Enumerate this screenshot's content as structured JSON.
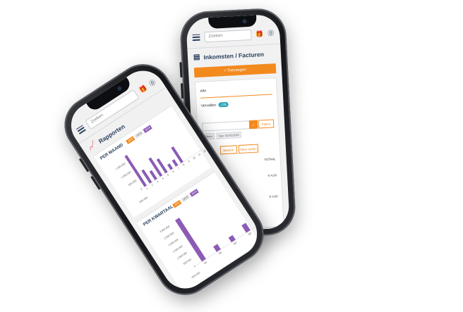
{
  "topbar": {
    "search_placeholder": "Zoeken"
  },
  "back_phone": {
    "title": "Inkomsten / Facturen",
    "new_button": "+ Toevoegen",
    "filter_all": "Alle",
    "filter_expired": "Vervallen",
    "expired_badge": "178",
    "search_button": "Filters",
    "chip_filters": "Filters",
    "chip_from": "Van: 01/01/2022",
    "action_1": "Bewerk",
    "action_2": "Meer opties",
    "col_total": "TOTAAL",
    "amount_1": "€ 4,00",
    "amount_2": "€ 0,00"
  },
  "front_phone": {
    "title": "Rapporten",
    "monthly": {
      "title": "PER MAAND",
      "legend": [
        "2022",
        "2023",
        "2024"
      ]
    },
    "quarterly": {
      "title": "PER KWARTAAL",
      "legend": [
        "2022",
        "2023",
        "2024"
      ]
    }
  },
  "colors": {
    "accent": "#f28a1e",
    "navy": "#2a3f5c",
    "purple": "#8b5bb5",
    "teal": "#2fa3b4"
  },
  "chart_data": [
    {
      "type": "bar",
      "title": "PER MAAND",
      "categories": [
        "1",
        "2",
        "3",
        "4",
        "5",
        "6",
        "7",
        "8",
        "9",
        "10",
        "11",
        "12"
      ],
      "series": [
        {
          "name": "2024",
          "values": [
            1800000,
            750000,
            500000,
            1050000,
            800000,
            300000,
            350000,
            900000,
            0,
            0,
            0,
            0
          ]
        }
      ],
      "ylim": [
        -500000,
        2000000
      ],
      "yticks": [
        "1.500.000",
        "1.000.000",
        "500.000",
        "0",
        "-500.000"
      ]
    },
    {
      "type": "bar",
      "title": "PER KWARTAAL",
      "categories": [
        "Q1",
        "Q2",
        "Q3",
        "Q4"
      ],
      "series": [
        {
          "name": "2024",
          "values": [
            3100000,
            400000,
            350000,
            550000
          ]
        }
      ],
      "ylim": [
        -500000,
        3500000
      ],
      "yticks": [
        "3.000.000",
        "2.500.000",
        "2.000.000",
        "1.500.000",
        "1.000.000",
        "500.000",
        "0",
        "-500.000"
      ]
    }
  ]
}
